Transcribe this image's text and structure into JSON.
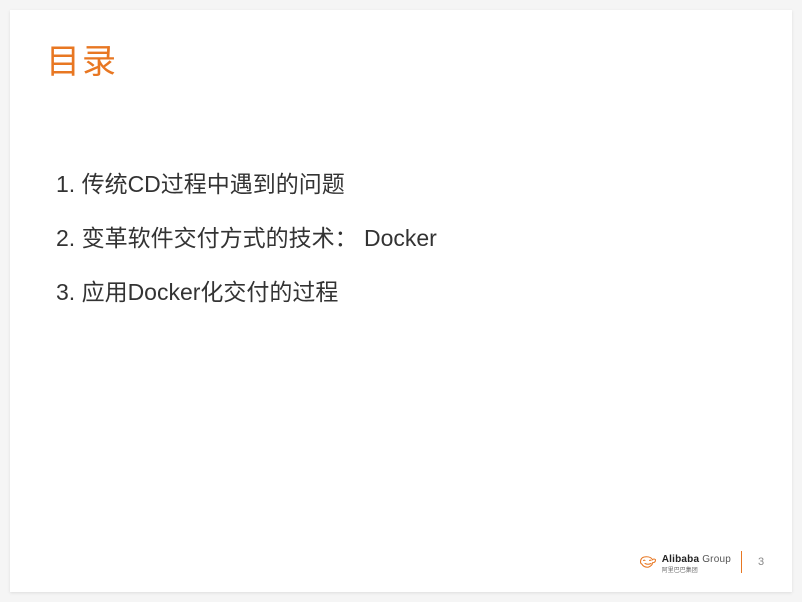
{
  "title": "目录",
  "items": [
    "1. 传统CD过程中遇到的问题",
    "2. 变革软件交付方式的技术： Docker",
    "3. 应用Docker化交付的过程"
  ],
  "footer": {
    "brand_en": "Alibaba",
    "brand_suffix": "Group",
    "brand_cn": "阿里巴巴集团",
    "page": "3"
  }
}
